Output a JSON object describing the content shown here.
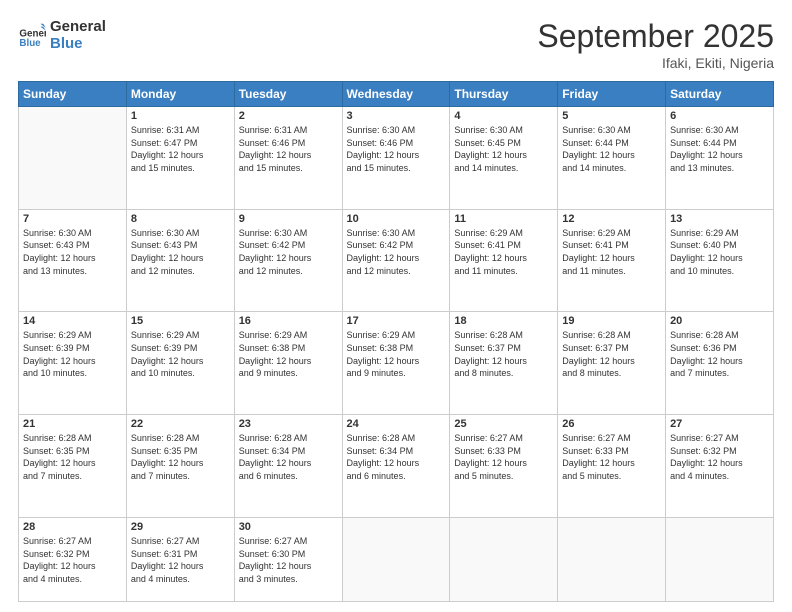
{
  "logo": {
    "general": "General",
    "blue": "Blue"
  },
  "header": {
    "month": "September 2025",
    "location": "Ifaki, Ekiti, Nigeria"
  },
  "weekdays": [
    "Sunday",
    "Monday",
    "Tuesday",
    "Wednesday",
    "Thursday",
    "Friday",
    "Saturday"
  ],
  "weeks": [
    [
      {
        "day": "",
        "info": ""
      },
      {
        "day": "1",
        "info": "Sunrise: 6:31 AM\nSunset: 6:47 PM\nDaylight: 12 hours\nand 15 minutes."
      },
      {
        "day": "2",
        "info": "Sunrise: 6:31 AM\nSunset: 6:46 PM\nDaylight: 12 hours\nand 15 minutes."
      },
      {
        "day": "3",
        "info": "Sunrise: 6:30 AM\nSunset: 6:46 PM\nDaylight: 12 hours\nand 15 minutes."
      },
      {
        "day": "4",
        "info": "Sunrise: 6:30 AM\nSunset: 6:45 PM\nDaylight: 12 hours\nand 14 minutes."
      },
      {
        "day": "5",
        "info": "Sunrise: 6:30 AM\nSunset: 6:44 PM\nDaylight: 12 hours\nand 14 minutes."
      },
      {
        "day": "6",
        "info": "Sunrise: 6:30 AM\nSunset: 6:44 PM\nDaylight: 12 hours\nand 13 minutes."
      }
    ],
    [
      {
        "day": "7",
        "info": "Sunrise: 6:30 AM\nSunset: 6:43 PM\nDaylight: 12 hours\nand 13 minutes."
      },
      {
        "day": "8",
        "info": "Sunrise: 6:30 AM\nSunset: 6:43 PM\nDaylight: 12 hours\nand 12 minutes."
      },
      {
        "day": "9",
        "info": "Sunrise: 6:30 AM\nSunset: 6:42 PM\nDaylight: 12 hours\nand 12 minutes."
      },
      {
        "day": "10",
        "info": "Sunrise: 6:30 AM\nSunset: 6:42 PM\nDaylight: 12 hours\nand 12 minutes."
      },
      {
        "day": "11",
        "info": "Sunrise: 6:29 AM\nSunset: 6:41 PM\nDaylight: 12 hours\nand 11 minutes."
      },
      {
        "day": "12",
        "info": "Sunrise: 6:29 AM\nSunset: 6:41 PM\nDaylight: 12 hours\nand 11 minutes."
      },
      {
        "day": "13",
        "info": "Sunrise: 6:29 AM\nSunset: 6:40 PM\nDaylight: 12 hours\nand 10 minutes."
      }
    ],
    [
      {
        "day": "14",
        "info": "Sunrise: 6:29 AM\nSunset: 6:39 PM\nDaylight: 12 hours\nand 10 minutes."
      },
      {
        "day": "15",
        "info": "Sunrise: 6:29 AM\nSunset: 6:39 PM\nDaylight: 12 hours\nand 10 minutes."
      },
      {
        "day": "16",
        "info": "Sunrise: 6:29 AM\nSunset: 6:38 PM\nDaylight: 12 hours\nand 9 minutes."
      },
      {
        "day": "17",
        "info": "Sunrise: 6:29 AM\nSunset: 6:38 PM\nDaylight: 12 hours\nand 9 minutes."
      },
      {
        "day": "18",
        "info": "Sunrise: 6:28 AM\nSunset: 6:37 PM\nDaylight: 12 hours\nand 8 minutes."
      },
      {
        "day": "19",
        "info": "Sunrise: 6:28 AM\nSunset: 6:37 PM\nDaylight: 12 hours\nand 8 minutes."
      },
      {
        "day": "20",
        "info": "Sunrise: 6:28 AM\nSunset: 6:36 PM\nDaylight: 12 hours\nand 7 minutes."
      }
    ],
    [
      {
        "day": "21",
        "info": "Sunrise: 6:28 AM\nSunset: 6:35 PM\nDaylight: 12 hours\nand 7 minutes."
      },
      {
        "day": "22",
        "info": "Sunrise: 6:28 AM\nSunset: 6:35 PM\nDaylight: 12 hours\nand 7 minutes."
      },
      {
        "day": "23",
        "info": "Sunrise: 6:28 AM\nSunset: 6:34 PM\nDaylight: 12 hours\nand 6 minutes."
      },
      {
        "day": "24",
        "info": "Sunrise: 6:28 AM\nSunset: 6:34 PM\nDaylight: 12 hours\nand 6 minutes."
      },
      {
        "day": "25",
        "info": "Sunrise: 6:27 AM\nSunset: 6:33 PM\nDaylight: 12 hours\nand 5 minutes."
      },
      {
        "day": "26",
        "info": "Sunrise: 6:27 AM\nSunset: 6:33 PM\nDaylight: 12 hours\nand 5 minutes."
      },
      {
        "day": "27",
        "info": "Sunrise: 6:27 AM\nSunset: 6:32 PM\nDaylight: 12 hours\nand 4 minutes."
      }
    ],
    [
      {
        "day": "28",
        "info": "Sunrise: 6:27 AM\nSunset: 6:32 PM\nDaylight: 12 hours\nand 4 minutes."
      },
      {
        "day": "29",
        "info": "Sunrise: 6:27 AM\nSunset: 6:31 PM\nDaylight: 12 hours\nand 4 minutes."
      },
      {
        "day": "30",
        "info": "Sunrise: 6:27 AM\nSunset: 6:30 PM\nDaylight: 12 hours\nand 3 minutes."
      },
      {
        "day": "",
        "info": ""
      },
      {
        "day": "",
        "info": ""
      },
      {
        "day": "",
        "info": ""
      },
      {
        "day": "",
        "info": ""
      }
    ]
  ]
}
